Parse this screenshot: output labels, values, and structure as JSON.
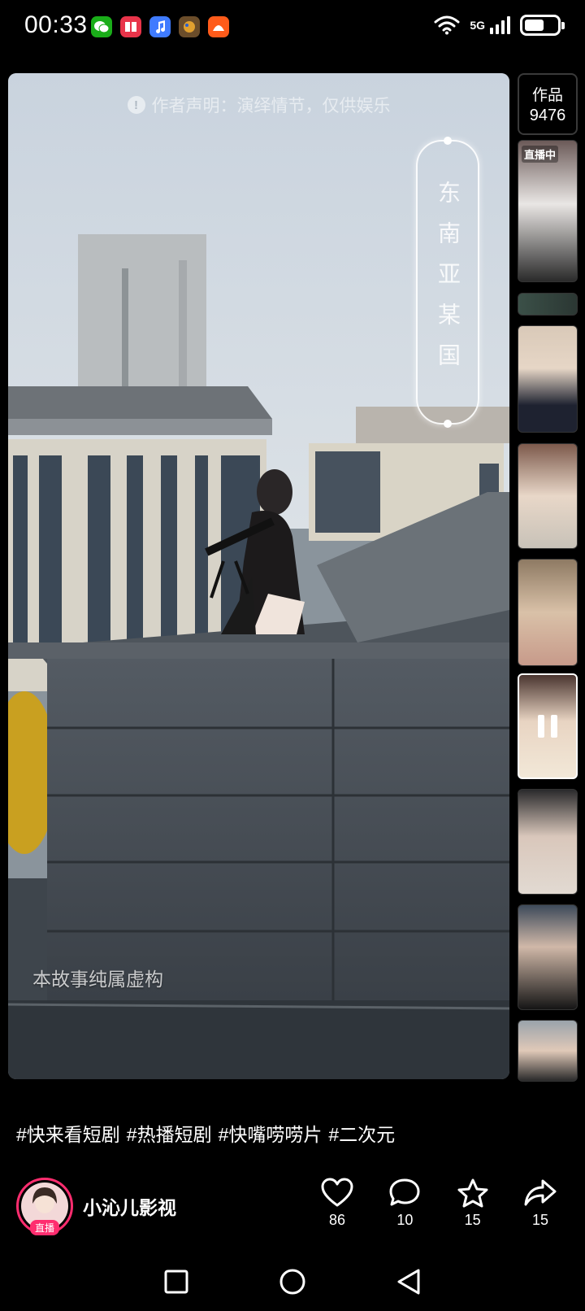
{
  "status_bar": {
    "time": "00:33",
    "network": "5G",
    "battery_percent": 60,
    "app_icons": [
      {
        "name": "wechat-icon",
        "color": "#1aad19"
      },
      {
        "name": "reader-icon",
        "color": "#e8344a"
      },
      {
        "name": "music-icon",
        "color": "#3f7bff"
      },
      {
        "name": "game-icon",
        "color": "#6b4d2a"
      },
      {
        "name": "taobao-icon",
        "color": "#ff5b1a"
      }
    ]
  },
  "video": {
    "disclaimer": "作者声明：演绎情节，仅供娱乐",
    "location_tag": "东南亚某国",
    "fiction_note": "本故事纯属虚构"
  },
  "side_panel": {
    "works_label": "作品",
    "works_count": "9476",
    "live_badge": "直播中"
  },
  "caption": {
    "hashtags": [
      "#快来看短剧",
      "#热播短剧",
      "#快嘴唠唠片",
      "#二次元"
    ]
  },
  "author": {
    "name": "小沁儿影视",
    "live_badge": "直播"
  },
  "actions": {
    "likes": "86",
    "comments": "10",
    "favorites": "15",
    "shares": "15"
  },
  "colors": {
    "accent": "#ff2d6f",
    "background": "#000000"
  }
}
